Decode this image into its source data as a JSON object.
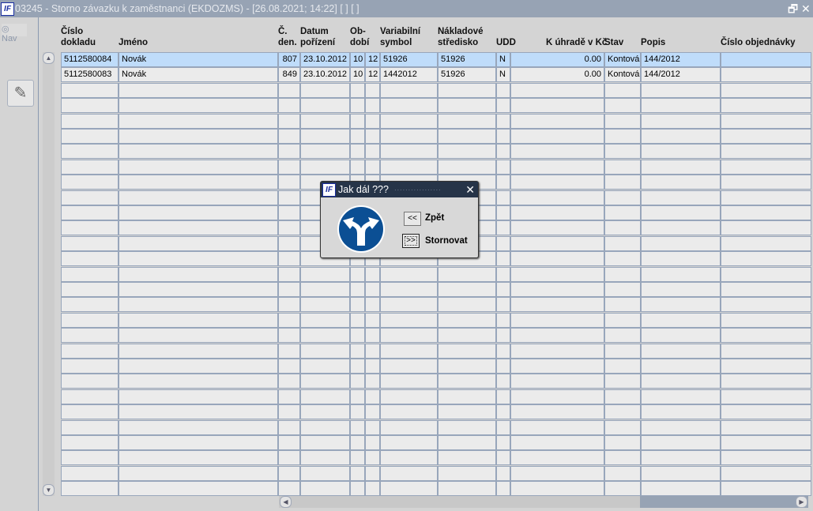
{
  "window": {
    "title": "03245 - Storno závazku k zaměstnanci (EKDOZMS) - [26.08.2021; 14:22]  [ ]  [ ]",
    "restore_icon": "restore-icon",
    "close_icon": "close-icon"
  },
  "sidebar": {
    "nav_label": "Nav"
  },
  "table": {
    "headers": [
      "Číslo\ndokladu",
      "Jméno",
      "Č.\nden.",
      "Datum\npořízení",
      "Ob-\ndobí",
      "",
      "Variabilní\nsymbol",
      "Nákladové\nstředisko",
      "UDD",
      "K úhradě v Kč",
      "Stav",
      "Popis",
      "Číslo objednávky"
    ],
    "rows": [
      [
        "5112580084",
        "Novák",
        "807",
        "23.10.2012",
        "10",
        "12",
        "51926",
        "51926",
        "N",
        "0.00",
        "Kontová",
        "144/2012",
        ""
      ],
      [
        "5112580083",
        "Novák",
        "849",
        "23.10.2012",
        "10",
        "12",
        "1442012",
        "51926",
        "N",
        "0.00",
        "Kontová",
        "144/2012",
        ""
      ]
    ],
    "selected_row": 0
  },
  "dialog": {
    "title": "Jak dál ???",
    "back_button": "<<",
    "back_label": "Zpět",
    "cancel_button": ">>",
    "cancel_label": "Stornovat",
    "sign_icon": "turn-left-or-right-sign-icon",
    "sign_color": "#0b4f94"
  }
}
